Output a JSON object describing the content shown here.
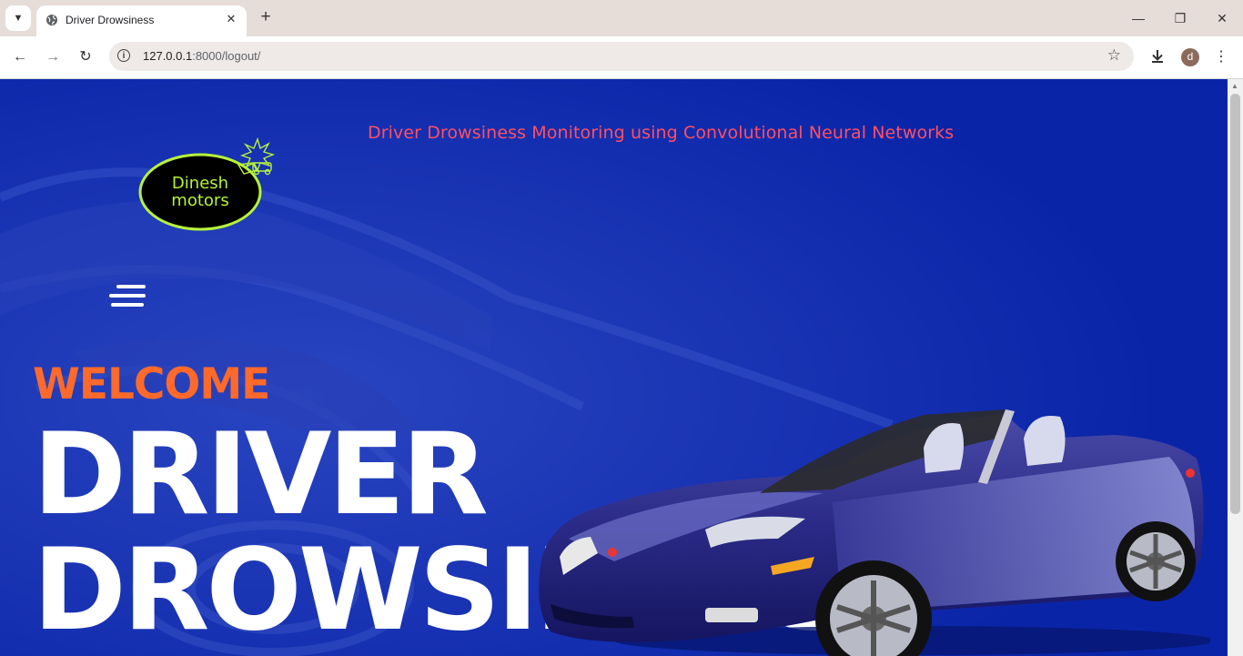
{
  "browser": {
    "tab_title": "Driver Drowsiness",
    "url_host": "127.0.0.1",
    "url_path": ":8000/logout/",
    "profile_initial": "d"
  },
  "page": {
    "site_title": "Driver Drowsiness Monitoring using Convolutional Neural Networks",
    "logo_text_line1": "Dinesh",
    "logo_text_line2": "motors",
    "welcome": "WELCOME",
    "hero_line1": "DRIVER",
    "hero_line2": "DROWSINESS"
  },
  "colors": {
    "page_background": "#0a24a8",
    "site_title": "#ff4f62",
    "welcome": "#ff6a2b",
    "logo_accent": "#b6f23a"
  },
  "icons": [
    "tab-search-icon",
    "globe-icon",
    "close-icon",
    "plus-icon",
    "minimize-icon",
    "restore-icon",
    "back-icon",
    "forward-icon",
    "reload-icon",
    "info-icon",
    "star-icon",
    "download-icon",
    "menu-icon",
    "hamburger-icon"
  ]
}
